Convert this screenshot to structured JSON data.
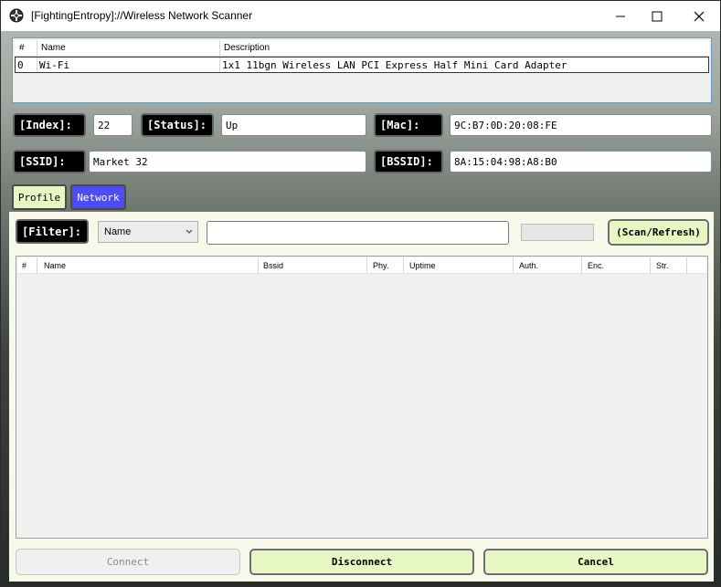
{
  "window": {
    "title": "[FightingEntropy]://Wireless Network Scanner"
  },
  "interfaces": {
    "columns": [
      "#",
      "Name",
      "Description"
    ],
    "rows": [
      {
        "index": "0",
        "name": "Wi-Fi",
        "description": "1x1 11bgn Wireless LAN PCI Express Half Mini Card Adapter"
      }
    ]
  },
  "details": {
    "index_label": "[Index]:",
    "index_value": "22",
    "status_label": "[Status]:",
    "status_value": "Up",
    "mac_label": "[Mac]:",
    "mac_value": "9C:B7:0D:20:08:FE",
    "ssid_label": "[SSID]:",
    "ssid_value": "Market 32",
    "bssid_label": "[BSSID]:",
    "bssid_value": "8A:15:04:98:A8:B0"
  },
  "tabs": [
    {
      "label": "Profile",
      "active": false
    },
    {
      "label": "Network",
      "active": true
    }
  ],
  "filter": {
    "label": "[Filter]:",
    "selected": "Name",
    "text_value": "",
    "scan_button": "(Scan/Refresh)"
  },
  "results": {
    "columns": [
      "#",
      "Name",
      "Bssid",
      "Phy.",
      "Uptime",
      "Auth.",
      "Enc.",
      "Str."
    ]
  },
  "actions": {
    "connect": "Connect",
    "disconnect": "Disconnect",
    "cancel": "Cancel"
  },
  "colors": {
    "tab_profile": "#e7f7c4",
    "tab_network": "#4d4df5",
    "button_green": "#e7f7c4",
    "button_disabled": "#f0f0f0",
    "selection_border": "#6e9ab8"
  }
}
